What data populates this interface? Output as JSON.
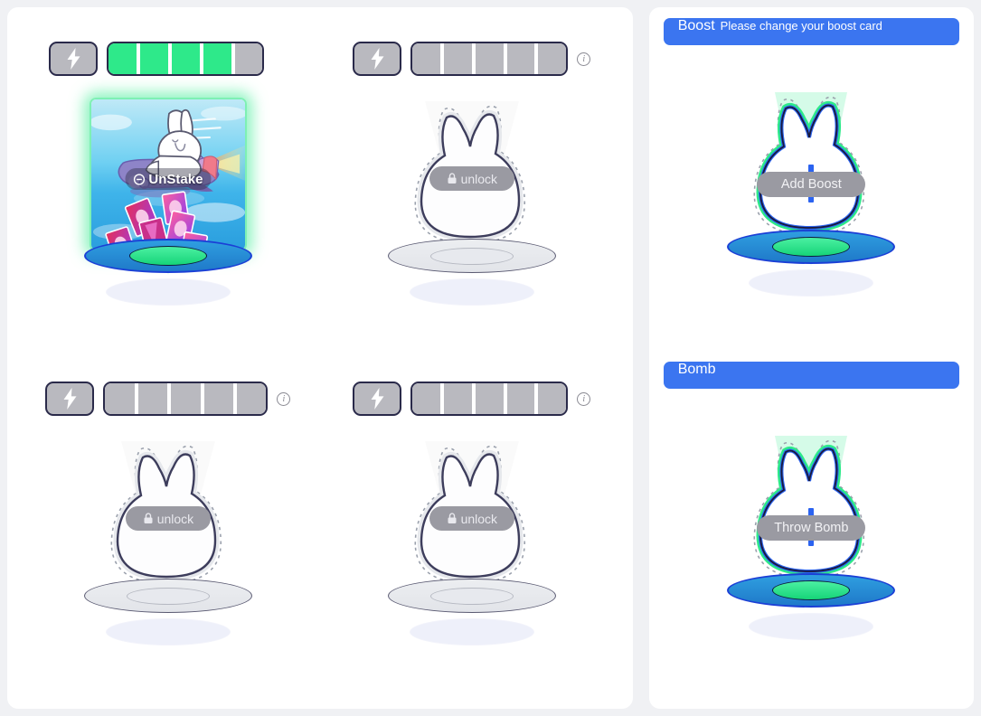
{
  "theme": {
    "page_bg": "#f0f1f4",
    "panel_bg": "#ffffff",
    "accent_blue": "#3b75f0",
    "energy_green": "#2ee98a",
    "energy_empty": "#b9b9bf",
    "outline_navy": "#2a2a4a",
    "pill_grey": "#9a9aa2"
  },
  "left_panel": {
    "name": "staking-slots-panel",
    "slots": [
      {
        "id": "slot-1",
        "state": "staked",
        "energy": {
          "filled": 4,
          "total": 5,
          "bolt_icon": "lightning-bolt-icon",
          "info_icon": false
        },
        "card": {
          "title_alt": "bunny-rocket-card",
          "action_label": "UnStake",
          "action_icon": "circle-minus-icon"
        }
      },
      {
        "id": "slot-2",
        "state": "locked",
        "energy": {
          "filled": 0,
          "total": 5,
          "bolt_icon": "lightning-bolt-icon",
          "info_icon": true
        },
        "card": {
          "action_label": "unlock",
          "action_icon": "lock-icon"
        }
      },
      {
        "id": "slot-3",
        "state": "locked",
        "energy": {
          "filled": 0,
          "total": 5,
          "bolt_icon": "lightning-bolt-icon",
          "info_icon": true
        },
        "card": {
          "action_label": "unlock",
          "action_icon": "lock-icon"
        }
      },
      {
        "id": "slot-4",
        "state": "locked",
        "energy": {
          "filled": 0,
          "total": 5,
          "bolt_icon": "lightning-bolt-icon",
          "info_icon": true
        },
        "card": {
          "action_label": "unlock",
          "action_icon": "lock-icon"
        }
      }
    ]
  },
  "right_panel": {
    "name": "boost-and-bomb-panel",
    "sections": [
      {
        "id": "boost",
        "header_title": "Boost",
        "header_note": "Please change your boost card",
        "action_label": "Add Boost",
        "action_icon": "plus-icon",
        "state": "empty-highlighted"
      },
      {
        "id": "bomb",
        "header_title": "Bomb",
        "header_note": "",
        "action_label": "Throw Bomb",
        "action_icon": "plus-icon",
        "state": "empty-highlighted"
      }
    ]
  },
  "icons": {
    "lightning": "lightning-bolt-icon",
    "info": "info-circle-icon",
    "lock": "lock-icon",
    "minus": "circle-minus-icon",
    "plus": "plus-icon"
  }
}
